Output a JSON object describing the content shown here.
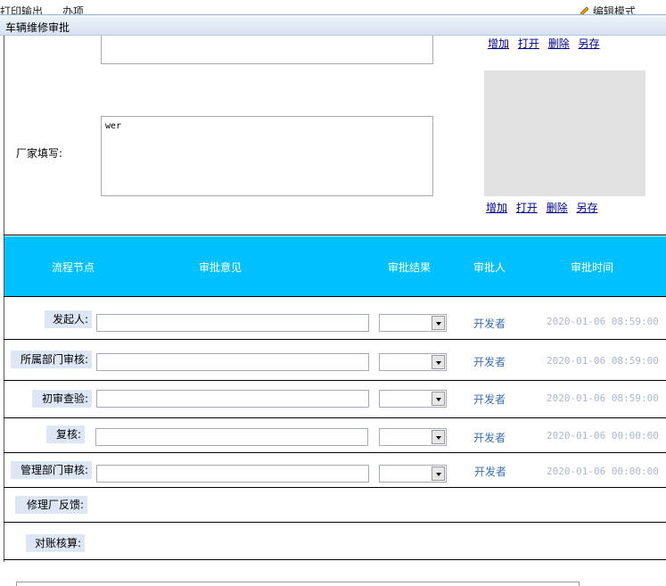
{
  "topbar": {
    "left_text": "打印输出",
    "left_text2": "办项",
    "right_text": "编辑模式"
  },
  "window": {
    "title": "车辆维修审批"
  },
  "form": {
    "factory_label": "厂家填写:",
    "factory_text": "wer",
    "attachments_top": [
      "增加",
      "打开",
      "删除",
      "另存"
    ],
    "attachments_bottom": [
      "增加",
      "打开",
      "删除",
      "另存"
    ]
  },
  "flow": {
    "headers": {
      "node": "流程节点",
      "opinion": "审批意见",
      "result": "审批结果",
      "approver": "审批人",
      "time": "审批时间"
    },
    "rows": [
      {
        "node": "发起人:",
        "approver": "开发者",
        "time": "2020-01-06 08:59:00"
      },
      {
        "node": "所属部门审核:",
        "approver": "开发者",
        "time": "2020-01-06 08:59:00"
      },
      {
        "node": "初审查验:",
        "approver": "开发者",
        "time": "2020-01-06 08:59:00"
      },
      {
        "node": "复核:",
        "approver": "开发者",
        "time": "2020-01-06 00:00:00"
      },
      {
        "node": "管理部门审核:",
        "approver": "开发者",
        "time": "2020-01-06 00:00:00"
      },
      {
        "node": "修理厂反馈:"
      },
      {
        "node": "对账核算:"
      }
    ]
  }
}
